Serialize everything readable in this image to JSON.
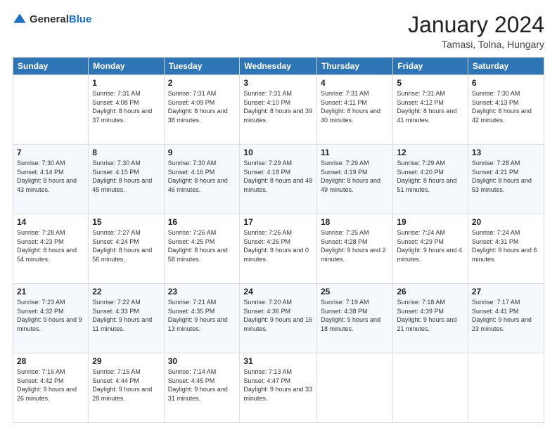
{
  "logo": {
    "general": "General",
    "blue": "Blue"
  },
  "header": {
    "month_year": "January 2024",
    "location": "Tamasi, Tolna, Hungary"
  },
  "days_of_week": [
    "Sunday",
    "Monday",
    "Tuesday",
    "Wednesday",
    "Thursday",
    "Friday",
    "Saturday"
  ],
  "weeks": [
    [
      {
        "day": "",
        "sunrise": "",
        "sunset": "",
        "daylight": ""
      },
      {
        "day": "1",
        "sunrise": "Sunrise: 7:31 AM",
        "sunset": "Sunset: 4:08 PM",
        "daylight": "Daylight: 8 hours and 37 minutes."
      },
      {
        "day": "2",
        "sunrise": "Sunrise: 7:31 AM",
        "sunset": "Sunset: 4:09 PM",
        "daylight": "Daylight: 8 hours and 38 minutes."
      },
      {
        "day": "3",
        "sunrise": "Sunrise: 7:31 AM",
        "sunset": "Sunset: 4:10 PM",
        "daylight": "Daylight: 8 hours and 39 minutes."
      },
      {
        "day": "4",
        "sunrise": "Sunrise: 7:31 AM",
        "sunset": "Sunset: 4:11 PM",
        "daylight": "Daylight: 8 hours and 40 minutes."
      },
      {
        "day": "5",
        "sunrise": "Sunrise: 7:31 AM",
        "sunset": "Sunset: 4:12 PM",
        "daylight": "Daylight: 8 hours and 41 minutes."
      },
      {
        "day": "6",
        "sunrise": "Sunrise: 7:30 AM",
        "sunset": "Sunset: 4:13 PM",
        "daylight": "Daylight: 8 hours and 42 minutes."
      }
    ],
    [
      {
        "day": "7",
        "sunrise": "Sunrise: 7:30 AM",
        "sunset": "Sunset: 4:14 PM",
        "daylight": "Daylight: 8 hours and 43 minutes."
      },
      {
        "day": "8",
        "sunrise": "Sunrise: 7:30 AM",
        "sunset": "Sunset: 4:15 PM",
        "daylight": "Daylight: 8 hours and 45 minutes."
      },
      {
        "day": "9",
        "sunrise": "Sunrise: 7:30 AM",
        "sunset": "Sunset: 4:16 PM",
        "daylight": "Daylight: 8 hours and 46 minutes."
      },
      {
        "day": "10",
        "sunrise": "Sunrise: 7:29 AM",
        "sunset": "Sunset: 4:18 PM",
        "daylight": "Daylight: 8 hours and 48 minutes."
      },
      {
        "day": "11",
        "sunrise": "Sunrise: 7:29 AM",
        "sunset": "Sunset: 4:19 PM",
        "daylight": "Daylight: 8 hours and 49 minutes."
      },
      {
        "day": "12",
        "sunrise": "Sunrise: 7:29 AM",
        "sunset": "Sunset: 4:20 PM",
        "daylight": "Daylight: 8 hours and 51 minutes."
      },
      {
        "day": "13",
        "sunrise": "Sunrise: 7:28 AM",
        "sunset": "Sunset: 4:21 PM",
        "daylight": "Daylight: 8 hours and 53 minutes."
      }
    ],
    [
      {
        "day": "14",
        "sunrise": "Sunrise: 7:28 AM",
        "sunset": "Sunset: 4:23 PM",
        "daylight": "Daylight: 8 hours and 54 minutes."
      },
      {
        "day": "15",
        "sunrise": "Sunrise: 7:27 AM",
        "sunset": "Sunset: 4:24 PM",
        "daylight": "Daylight: 8 hours and 56 minutes."
      },
      {
        "day": "16",
        "sunrise": "Sunrise: 7:26 AM",
        "sunset": "Sunset: 4:25 PM",
        "daylight": "Daylight: 8 hours and 58 minutes."
      },
      {
        "day": "17",
        "sunrise": "Sunrise: 7:26 AM",
        "sunset": "Sunset: 4:26 PM",
        "daylight": "Daylight: 9 hours and 0 minutes."
      },
      {
        "day": "18",
        "sunrise": "Sunrise: 7:25 AM",
        "sunset": "Sunset: 4:28 PM",
        "daylight": "Daylight: 9 hours and 2 minutes."
      },
      {
        "day": "19",
        "sunrise": "Sunrise: 7:24 AM",
        "sunset": "Sunset: 4:29 PM",
        "daylight": "Daylight: 9 hours and 4 minutes."
      },
      {
        "day": "20",
        "sunrise": "Sunrise: 7:24 AM",
        "sunset": "Sunset: 4:31 PM",
        "daylight": "Daylight: 9 hours and 6 minutes."
      }
    ],
    [
      {
        "day": "21",
        "sunrise": "Sunrise: 7:23 AM",
        "sunset": "Sunset: 4:32 PM",
        "daylight": "Daylight: 9 hours and 9 minutes."
      },
      {
        "day": "22",
        "sunrise": "Sunrise: 7:22 AM",
        "sunset": "Sunset: 4:33 PM",
        "daylight": "Daylight: 9 hours and 11 minutes."
      },
      {
        "day": "23",
        "sunrise": "Sunrise: 7:21 AM",
        "sunset": "Sunset: 4:35 PM",
        "daylight": "Daylight: 9 hours and 13 minutes."
      },
      {
        "day": "24",
        "sunrise": "Sunrise: 7:20 AM",
        "sunset": "Sunset: 4:36 PM",
        "daylight": "Daylight: 9 hours and 16 minutes."
      },
      {
        "day": "25",
        "sunrise": "Sunrise: 7:19 AM",
        "sunset": "Sunset: 4:38 PM",
        "daylight": "Daylight: 9 hours and 18 minutes."
      },
      {
        "day": "26",
        "sunrise": "Sunrise: 7:18 AM",
        "sunset": "Sunset: 4:39 PM",
        "daylight": "Daylight: 9 hours and 21 minutes."
      },
      {
        "day": "27",
        "sunrise": "Sunrise: 7:17 AM",
        "sunset": "Sunset: 4:41 PM",
        "daylight": "Daylight: 9 hours and 23 minutes."
      }
    ],
    [
      {
        "day": "28",
        "sunrise": "Sunrise: 7:16 AM",
        "sunset": "Sunset: 4:42 PM",
        "daylight": "Daylight: 9 hours and 26 minutes."
      },
      {
        "day": "29",
        "sunrise": "Sunrise: 7:15 AM",
        "sunset": "Sunset: 4:44 PM",
        "daylight": "Daylight: 9 hours and 28 minutes."
      },
      {
        "day": "30",
        "sunrise": "Sunrise: 7:14 AM",
        "sunset": "Sunset: 4:45 PM",
        "daylight": "Daylight: 9 hours and 31 minutes."
      },
      {
        "day": "31",
        "sunrise": "Sunrise: 7:13 AM",
        "sunset": "Sunset: 4:47 PM",
        "daylight": "Daylight: 9 hours and 33 minutes."
      },
      {
        "day": "",
        "sunrise": "",
        "sunset": "",
        "daylight": ""
      },
      {
        "day": "",
        "sunrise": "",
        "sunset": "",
        "daylight": ""
      },
      {
        "day": "",
        "sunrise": "",
        "sunset": "",
        "daylight": ""
      }
    ]
  ]
}
